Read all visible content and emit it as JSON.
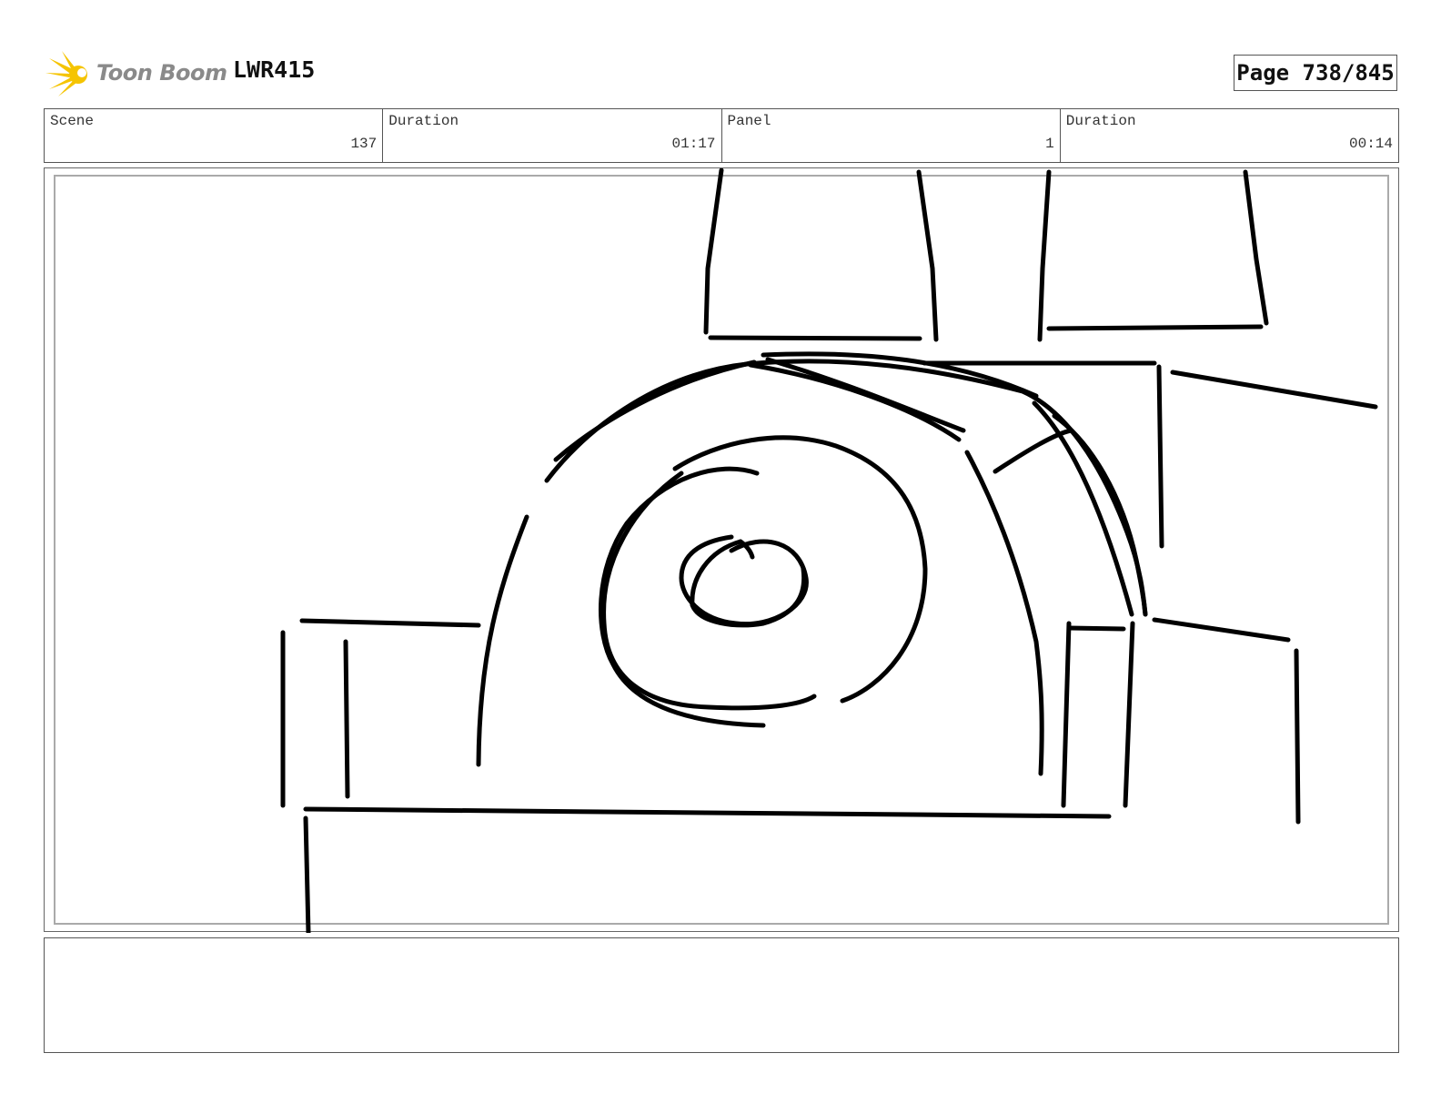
{
  "header": {
    "logo_text": "Toon Boom",
    "project_code": "LWR415",
    "page_label": "Page 738/845"
  },
  "info": {
    "scene_label": "Scene",
    "scene_value": "137",
    "scene_duration_label": "Duration",
    "scene_duration_value": "01:17",
    "panel_label": "Panel",
    "panel_value": "1",
    "panel_duration_label": "Duration",
    "panel_duration_value": "00:14"
  },
  "notes": {
    "text": ""
  },
  "colors": {
    "logo_yellow": "#f5c400",
    "logo_text": "#8a8a8a",
    "ink": "#000000",
    "frame_border": "#aaaaaa"
  }
}
